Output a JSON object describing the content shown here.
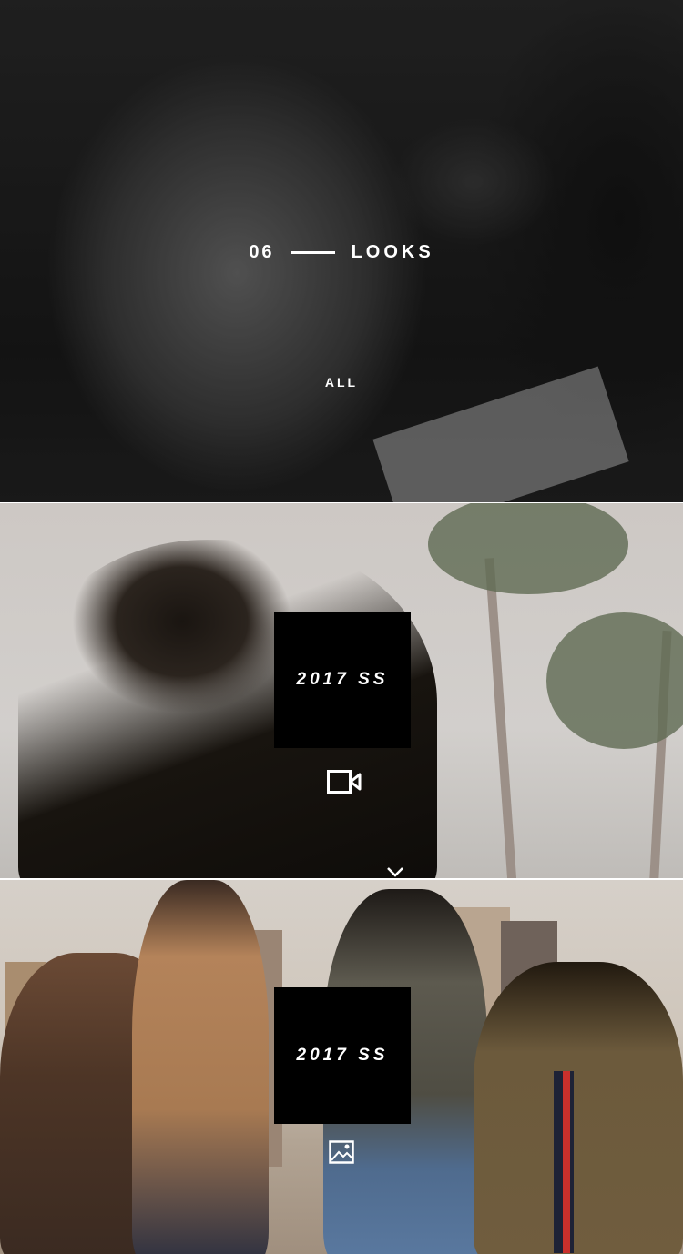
{
  "hero": {
    "count": "06",
    "title": "LOOKS",
    "filter_label": "ALL"
  },
  "collections": [
    {
      "label": "2017 SS",
      "media_icon": "video-camera-icon"
    },
    {
      "label": "2017 SS",
      "media_icon": "image-icon"
    }
  ],
  "scroll_icon": "chevron-down-icon",
  "colors": {
    "label_bg": "#000000",
    "text": "#ffffff"
  }
}
